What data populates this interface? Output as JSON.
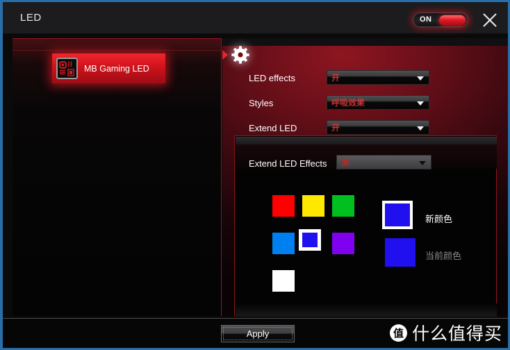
{
  "window": {
    "title": "LED",
    "power_toggle_label": "ON",
    "close_icon": "close-icon",
    "accent_color": "#cf121c",
    "border_color": "#2a6ea8"
  },
  "sidebar": {
    "items": [
      {
        "label": "MB Gaming LED",
        "icon": "motherboard-icon",
        "selected": true
      }
    ]
  },
  "main": {
    "header_icon": "gear-icon",
    "settings": [
      {
        "label": "LED effects",
        "value": "开"
      },
      {
        "label": "Styles",
        "value": "呼吸效果"
      },
      {
        "label": "Extend LED",
        "value": "开"
      }
    ],
    "extend_panel": {
      "label": "Extend LED Effects",
      "value": "关",
      "swatches": [
        {
          "name": "red",
          "color": "#FF0000",
          "selected": false
        },
        {
          "name": "yellow",
          "color": "#FFE800",
          "selected": false
        },
        {
          "name": "green",
          "color": "#00C020",
          "selected": false
        },
        {
          "name": "light-blue",
          "color": "#0080F0",
          "selected": false
        },
        {
          "name": "blue",
          "color": "#2010F0",
          "selected": true
        },
        {
          "name": "purple",
          "color": "#8000F0",
          "selected": false
        },
        {
          "name": "white",
          "color": "#FFFFFF",
          "selected": false
        }
      ],
      "new_color": {
        "label": "新颜色",
        "color": "#2010F0"
      },
      "current_color": {
        "label": "当前颜色",
        "color": "#2010F0"
      }
    }
  },
  "footer": {
    "apply_label": "Apply"
  },
  "watermark": {
    "logo_char": "值",
    "text": "什么值得买"
  }
}
